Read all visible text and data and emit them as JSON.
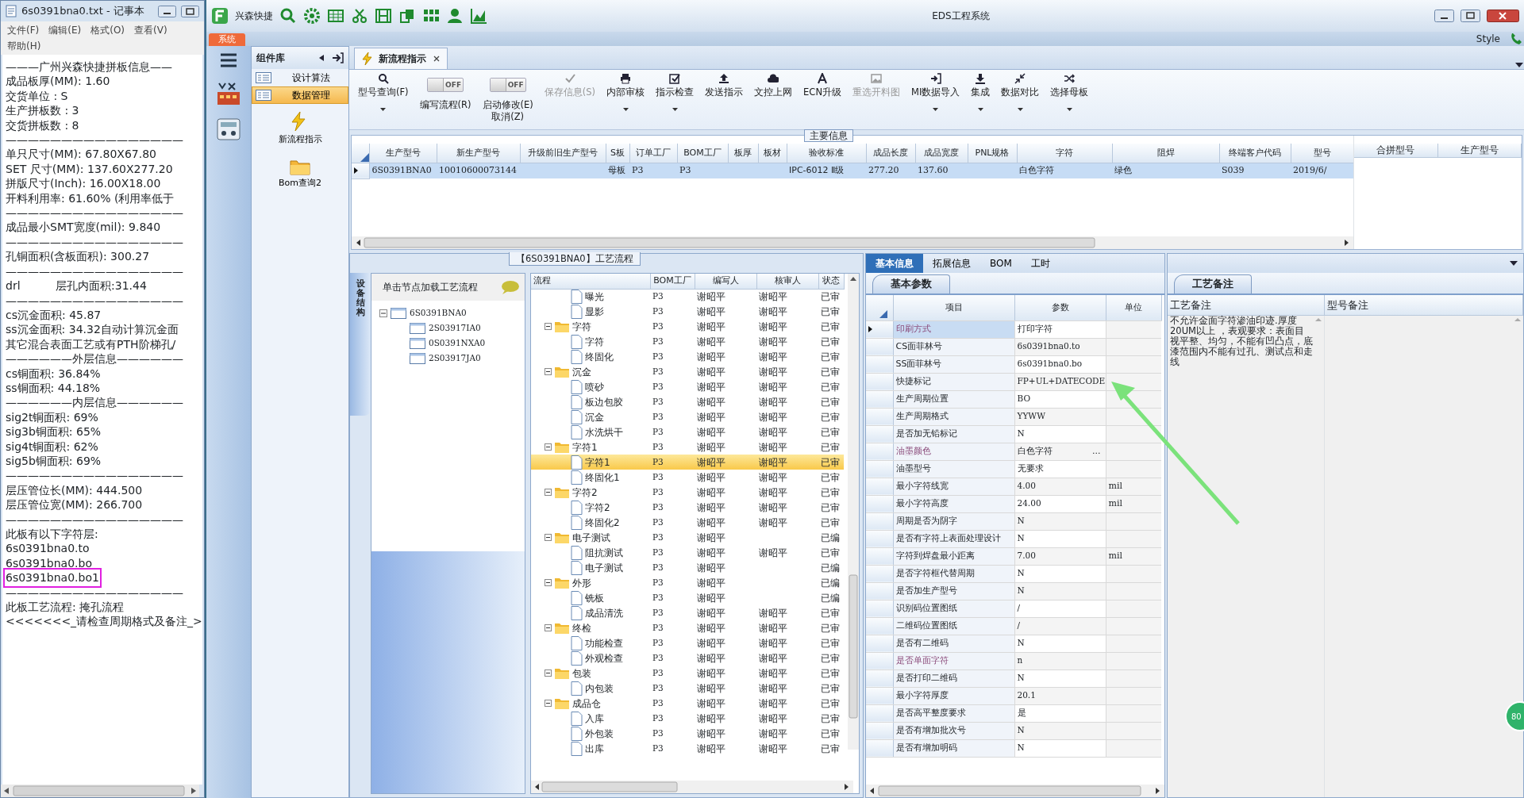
{
  "notepad": {
    "title": "6s0391bna0.txt - 记事本",
    "menu": [
      "文件(F)",
      "编辑(E)",
      "格式(O)",
      "查看(V)",
      "帮助(H)"
    ],
    "lines": [
      {
        "text": "———广州兴森快捷拼板信息——",
        "highlighted": false
      },
      {
        "text": "成品板厚(MM): 1.60",
        "highlighted": false
      },
      {
        "text": "交货单位 : S",
        "highlighted": false
      },
      {
        "text": "生产拼板数 : 3",
        "highlighted": false
      },
      {
        "text": "交货拼板数 : 8",
        "highlighted": false
      },
      {
        "text": "————————————————",
        "highlighted": false
      },
      {
        "text": "单只尺寸(MM): 67.80X67.80",
        "highlighted": false
      },
      {
        "text": "SET 尺寸(MM): 137.60X277.20",
        "highlighted": false
      },
      {
        "text": "拼版尺寸(Inch): 16.00X18.00",
        "highlighted": false
      },
      {
        "text": "开料利用率: 61.60% (利用率低于",
        "highlighted": false
      },
      {
        "text": "————————————————",
        "highlighted": false
      },
      {
        "text": "成品最小SMT宽度(mil): 9.840",
        "highlighted": false
      },
      {
        "text": "————————————————",
        "highlighted": false
      },
      {
        "text": "孔铜面积(含板面积): 300.27",
        "highlighted": false
      },
      {
        "text": "————————————————",
        "highlighted": false
      },
      {
        "text": "drl          层孔内面积:31.44",
        "highlighted": false
      },
      {
        "text": "————————————————",
        "highlighted": false
      },
      {
        "text": "cs沉金面积: 45.87",
        "highlighted": false
      },
      {
        "text": "ss沉金面积: 34.32自动计算沉金面",
        "highlighted": false
      },
      {
        "text": "其它混合表面工艺或有PTH阶梯孔/",
        "highlighted": false
      },
      {
        "text": "——————外层信息——————",
        "highlighted": false
      },
      {
        "text": "cs铜面积: 36.84%",
        "highlighted": false
      },
      {
        "text": "ss铜面积: 44.18%",
        "highlighted": false
      },
      {
        "text": "——————内层信息——————",
        "highlighted": false
      },
      {
        "text": "sig2t铜面积: 69%",
        "highlighted": false
      },
      {
        "text": "sig3b铜面积: 65%",
        "highlighted": false
      },
      {
        "text": "sig4t铜面积: 62%",
        "highlighted": false
      },
      {
        "text": "sig5b铜面积: 69%",
        "highlighted": false
      },
      {
        "text": "————————————————",
        "highlighted": false
      },
      {
        "text": "层压管位长(MM): 444.500",
        "highlighted": false
      },
      {
        "text": "层压管位宽(MM): 266.700",
        "highlighted": false
      },
      {
        "text": "————————————————",
        "highlighted": false
      },
      {
        "text": "此板有以下字符层:",
        "highlighted": false
      },
      {
        "text": "6s0391bna0.to",
        "highlighted": false
      },
      {
        "text": "6s0391bna0.bo",
        "highlighted": false
      },
      {
        "text": "6s0391bna0.bo1",
        "highlighted": true
      },
      {
        "text": "————————————————",
        "highlighted": false
      },
      {
        "text": "此板工艺流程: 掩孔流程",
        "highlighted": false
      },
      {
        "text": "<<<<<<<_请检查周期格式及备注_>",
        "highlighted": false
      }
    ]
  },
  "app": {
    "title": "EDS工程系统",
    "brand": "兴森快捷",
    "system_tab": "系统",
    "style_label": "Style",
    "floating_badge": "80"
  },
  "component_panel": {
    "title": "组件库",
    "items": [
      {
        "label": "设计算法",
        "selected": false
      },
      {
        "label": "数据管理",
        "selected": true
      }
    ],
    "shortcuts": [
      "新流程指示",
      "Bom查询2"
    ]
  },
  "document_tab": {
    "label": "新流程指示"
  },
  "toolbar": [
    {
      "kind": "button",
      "label": "型号查询(F)",
      "dropdown": true,
      "disabled": false
    },
    {
      "kind": "toggle",
      "label": "编写流程(R)",
      "state": "OFF",
      "on": false
    },
    {
      "kind": "toggle",
      "label": "启动修改(E)",
      "sublabel": "取消(Z)",
      "state": "OFF",
      "on": false
    },
    {
      "kind": "button",
      "label": "保存信息(S)",
      "dropdown": false,
      "disabled": true
    },
    {
      "kind": "button",
      "label": "内部审核",
      "dropdown": true,
      "disabled": false
    },
    {
      "kind": "button",
      "label": "指示检查",
      "dropdown": true,
      "disabled": false
    },
    {
      "kind": "button",
      "label": "发送指示",
      "dropdown": false,
      "disabled": false
    },
    {
      "kind": "button",
      "label": "文控上网",
      "dropdown": false,
      "disabled": false
    },
    {
      "kind": "button",
      "label": "ECN升级",
      "dropdown": false,
      "disabled": false
    },
    {
      "kind": "button",
      "label": "重选开料图",
      "dropdown": false,
      "disabled": true
    },
    {
      "kind": "button",
      "label": "MI数据导入",
      "dropdown": true,
      "disabled": false
    },
    {
      "kind": "button",
      "label": "集成",
      "dropdown": true,
      "disabled": false
    },
    {
      "kind": "button",
      "label": "数据对比",
      "dropdown": true,
      "disabled": false
    },
    {
      "kind": "button",
      "label": "选择母板",
      "dropdown": true,
      "disabled": false
    }
  ],
  "main_info": {
    "title": "主要信息",
    "columns": [
      "生产型号",
      "新生产型号",
      "升级前旧生产型号",
      "S板",
      "订单工厂",
      "BOM工厂",
      "板厚",
      "板材",
      "验收标准",
      "成品长度",
      "成品宽度",
      "PNL规格",
      "字符",
      "阻焊",
      "终端客户代码",
      "型号"
    ],
    "rows": [
      {
        "current": true,
        "cells": [
          "6S0391BNA0",
          "10010600073144",
          null,
          "母板",
          "P3",
          "P3",
          null,
          null,
          "IPC-6012 Ⅱ级",
          "277.20",
          "137.60",
          null,
          "白色字符",
          "绿色",
          "S039",
          "2019/6/"
        ]
      }
    ],
    "side_columns": [
      "合拼型号",
      "生产型号"
    ]
  },
  "process": {
    "title": "【6S0391BNA0】工艺流程",
    "side_tab": "设备结构",
    "tree_header": "单击节点加载工艺流程",
    "tree": [
      {
        "label": "6S0391BNA0",
        "expanded": true,
        "children": [
          {
            "label": "2S03917IA0"
          },
          {
            "label": "0S0391NXA0"
          },
          {
            "label": "2S03917JA0"
          }
        ]
      }
    ],
    "columns": [
      "流程",
      "BOM工厂",
      "编写人",
      "核审人",
      "状态"
    ],
    "rows": [
      {
        "kind": "step",
        "name": "曝光",
        "bom": "P3",
        "writer": "谢昭平",
        "reviewer": "谢昭平",
        "status": "已审",
        "selected": false
      },
      {
        "kind": "step",
        "name": "显影",
        "bom": "P3",
        "writer": "谢昭平",
        "reviewer": "谢昭平",
        "status": "已审",
        "selected": false
      },
      {
        "kind": "group",
        "name": "字符",
        "bom": "P3",
        "writer": "谢昭平",
        "reviewer": "谢昭平",
        "status": "已审",
        "selected": false,
        "children": [
          {
            "kind": "step",
            "name": "字符",
            "bom": "P3",
            "writer": "谢昭平",
            "reviewer": "谢昭平",
            "status": "已审",
            "selected": false
          },
          {
            "kind": "step",
            "name": "终固化",
            "bom": "P3",
            "writer": "谢昭平",
            "reviewer": "谢昭平",
            "status": "已审",
            "selected": false
          }
        ]
      },
      {
        "kind": "group",
        "name": "沉金",
        "bom": "P3",
        "writer": "谢昭平",
        "reviewer": "谢昭平",
        "status": "已审",
        "selected": false,
        "children": [
          {
            "kind": "step",
            "name": "喷砂",
            "bom": "P3",
            "writer": "谢昭平",
            "reviewer": "谢昭平",
            "status": "已审",
            "selected": false
          },
          {
            "kind": "step",
            "name": "板边包胶",
            "bom": "P3",
            "writer": "谢昭平",
            "reviewer": "谢昭平",
            "status": "已审",
            "selected": false
          },
          {
            "kind": "step",
            "name": "沉金",
            "bom": "P3",
            "writer": "谢昭平",
            "reviewer": "谢昭平",
            "status": "已审",
            "selected": false
          },
          {
            "kind": "step",
            "name": "水洗烘干",
            "bom": "P3",
            "writer": "谢昭平",
            "reviewer": "谢昭平",
            "status": "已审",
            "selected": false
          }
        ]
      },
      {
        "kind": "group",
        "name": "字符1",
        "bom": "P3",
        "writer": "谢昭平",
        "reviewer": "谢昭平",
        "status": "已审",
        "selected": false,
        "children": [
          {
            "kind": "step",
            "name": "字符1",
            "bom": "P3",
            "writer": "谢昭平",
            "reviewer": "谢昭平",
            "status": "已审",
            "selected": true
          },
          {
            "kind": "step",
            "name": "终固化1",
            "bom": "P3",
            "writer": "谢昭平",
            "reviewer": "谢昭平",
            "status": "已审",
            "selected": false
          }
        ]
      },
      {
        "kind": "group",
        "name": "字符2",
        "bom": "P3",
        "writer": "谢昭平",
        "reviewer": "谢昭平",
        "status": "已审",
        "selected": false,
        "children": [
          {
            "kind": "step",
            "name": "字符2",
            "bom": "P3",
            "writer": "谢昭平",
            "reviewer": "谢昭平",
            "status": "已审",
            "selected": false
          },
          {
            "kind": "step",
            "name": "终固化2",
            "bom": "P3",
            "writer": "谢昭平",
            "reviewer": "谢昭平",
            "status": "已审",
            "selected": false
          }
        ]
      },
      {
        "kind": "group",
        "name": "电子测试",
        "bom": "P3",
        "writer": "谢昭平",
        "status": "已编",
        "selected": false,
        "children": [
          {
            "kind": "step",
            "name": "阻抗测试",
            "bom": "P3",
            "writer": "谢昭平",
            "reviewer": "谢昭平",
            "status": "已审",
            "selected": false
          },
          {
            "kind": "step",
            "name": "电子测试",
            "bom": "P3",
            "writer": "谢昭平",
            "status": "已编",
            "selected": false
          }
        ]
      },
      {
        "kind": "group",
        "name": "外形",
        "bom": "P3",
        "writer": "谢昭平",
        "status": "已编",
        "selected": false,
        "children": [
          {
            "kind": "step",
            "name": "铣板",
            "bom": "P3",
            "writer": "谢昭平",
            "status": "已编",
            "selected": false
          },
          {
            "kind": "step",
            "name": "成品清洗",
            "bom": "P3",
            "writer": "谢昭平",
            "reviewer": "谢昭平",
            "status": "已审",
            "selected": false
          }
        ]
      },
      {
        "kind": "group",
        "name": "终检",
        "bom": "P3",
        "writer": "谢昭平",
        "reviewer": "谢昭平",
        "status": "已审",
        "selected": false,
        "children": [
          {
            "kind": "step",
            "name": "功能检查",
            "bom": "P3",
            "writer": "谢昭平",
            "reviewer": "谢昭平",
            "status": "已审",
            "selected": false
          },
          {
            "kind": "step",
            "name": "外观检查",
            "bom": "P3",
            "writer": "谢昭平",
            "reviewer": "谢昭平",
            "status": "已审",
            "selected": false
          }
        ]
      },
      {
        "kind": "group",
        "name": "包装",
        "bom": "P3",
        "writer": "谢昭平",
        "reviewer": "谢昭平",
        "status": "已审",
        "selected": false,
        "children": [
          {
            "kind": "step",
            "name": "内包装",
            "bom": "P3",
            "writer": "谢昭平",
            "reviewer": "谢昭平",
            "status": "已审",
            "selected": false
          }
        ]
      },
      {
        "kind": "group",
        "name": "成品仓",
        "bom": "P3",
        "writer": "谢昭平",
        "reviewer": "谢昭平",
        "status": "已审",
        "selected": false,
        "children": [
          {
            "kind": "step",
            "name": "入库",
            "bom": "P3",
            "writer": "谢昭平",
            "reviewer": "谢昭平",
            "status": "已审",
            "selected": false
          },
          {
            "kind": "step",
            "name": "外包装",
            "bom": "P3",
            "writer": "谢昭平",
            "reviewer": "谢昭平",
            "status": "已审",
            "selected": false
          },
          {
            "kind": "step",
            "name": "出库",
            "bom": "P3",
            "writer": "谢昭平",
            "reviewer": "谢昭平",
            "status": "已审",
            "selected": false
          }
        ]
      }
    ]
  },
  "params": {
    "tabs": [
      {
        "label": "基本信息",
        "selected": true
      },
      {
        "label": "拓展信息",
        "selected": false
      },
      {
        "label": "BOM",
        "selected": false
      },
      {
        "label": "工时",
        "selected": false
      }
    ],
    "subtab": "基本参数",
    "columns": [
      "项目",
      "参数",
      "单位"
    ],
    "rows": [
      {
        "item": "印刷方式",
        "value": "打印字符",
        "flagged": true,
        "current": true
      },
      {
        "item": "CS面菲林号",
        "value": "6s0391bna0.to",
        "flagged": false,
        "current": false
      },
      {
        "item": "SS面菲林号",
        "value": "6s0391bna0.bo",
        "flagged": false,
        "current": false
      },
      {
        "item": "快捷标记",
        "value": "FP+UL+DATECODE",
        "flagged": false,
        "current": false
      },
      {
        "item": "生产周期位置",
        "value": "BO",
        "flagged": false,
        "current": false
      },
      {
        "item": "生产周期格式",
        "value": "YYWW",
        "flagged": false,
        "current": false
      },
      {
        "item": "是否加无铅标记",
        "value": "N",
        "flagged": false,
        "current": false
      },
      {
        "item": "油墨颜色",
        "value": "白色字符",
        "picker": "...",
        "flagged": true,
        "current": false
      },
      {
        "item": "油墨型号",
        "value": "无要求",
        "flagged": false,
        "current": false
      },
      {
        "item": "最小字符线宽",
        "value": "4.00",
        "unit": "mil",
        "flagged": false,
        "current": false
      },
      {
        "item": "最小字符高度",
        "value": "24.00",
        "unit": "mil",
        "flagged": false,
        "current": false
      },
      {
        "item": "周期是否为阴字",
        "value": "N",
        "flagged": false,
        "current": false
      },
      {
        "item": "是否有字符上表面处理设计",
        "value": "N",
        "flagged": false,
        "current": false
      },
      {
        "item": "字符到焊盘最小距离",
        "value": "7.00",
        "unit": "mil",
        "flagged": false,
        "current": false
      },
      {
        "item": "是否字符框代替周期",
        "value": "N",
        "flagged": false,
        "current": false
      },
      {
        "item": "是否加生产型号",
        "value": "N",
        "flagged": false,
        "current": false
      },
      {
        "item": "识别码位置图纸",
        "value": "/",
        "flagged": false,
        "current": false
      },
      {
        "item": "二维码位置图纸",
        "value": "/",
        "flagged": false,
        "current": false
      },
      {
        "item": "是否有二维码",
        "value": "N",
        "flagged": false,
        "current": false
      },
      {
        "item": "是否单面字符",
        "value": "n",
        "flagged": true,
        "current": false
      },
      {
        "item": "是否打印二维码",
        "value": "N",
        "flagged": false,
        "current": false
      },
      {
        "item": "最小字符厚度",
        "value": "20.1",
        "flagged": false,
        "current": false
      },
      {
        "item": "是否高平整度要求",
        "value": "是",
        "flagged": false,
        "current": false
      },
      {
        "item": "是否有增加批次号",
        "value": "N",
        "flagged": false,
        "current": false
      },
      {
        "item": "是否有增加明码",
        "value": "N",
        "flagged": false,
        "current": false
      }
    ]
  },
  "remarks": {
    "subtab": "工艺备注",
    "columns": [
      "工艺备注",
      "型号备注"
    ],
    "process_note": "不允许金面字符渗油印迹.厚度20UM以上 ，表观要求：表面目视平整、均匀，不能有凹凸点，底漆范围内不能有过孔、测试点和走线"
  }
}
